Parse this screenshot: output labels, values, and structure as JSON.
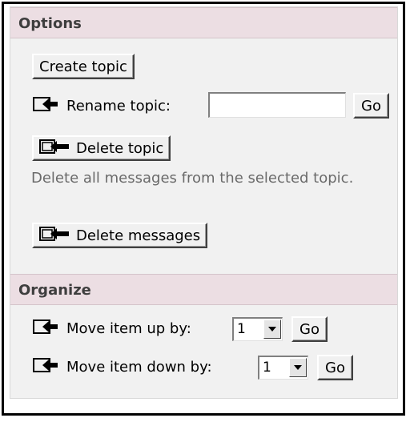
{
  "options": {
    "header": "Options",
    "create_topic_label": "Create topic",
    "rename_topic_label": "Rename topic:",
    "rename_topic_value": "",
    "rename_go_label": "Go",
    "delete_topic_label": "Delete topic",
    "delete_messages_description": "Delete all messages from the selected topic.",
    "delete_messages_label": "Delete messages"
  },
  "organize": {
    "header": "Organize",
    "move_up_label": "Move item up by:",
    "move_up_value": "1",
    "move_up_go_label": "Go",
    "move_down_label": "Move item down by:",
    "move_down_value": "1",
    "move_down_go_label": "Go"
  },
  "icons": {
    "arrow_icon": "arrow-into-box-icon",
    "dropdown_icon": "chevron-down-icon"
  }
}
